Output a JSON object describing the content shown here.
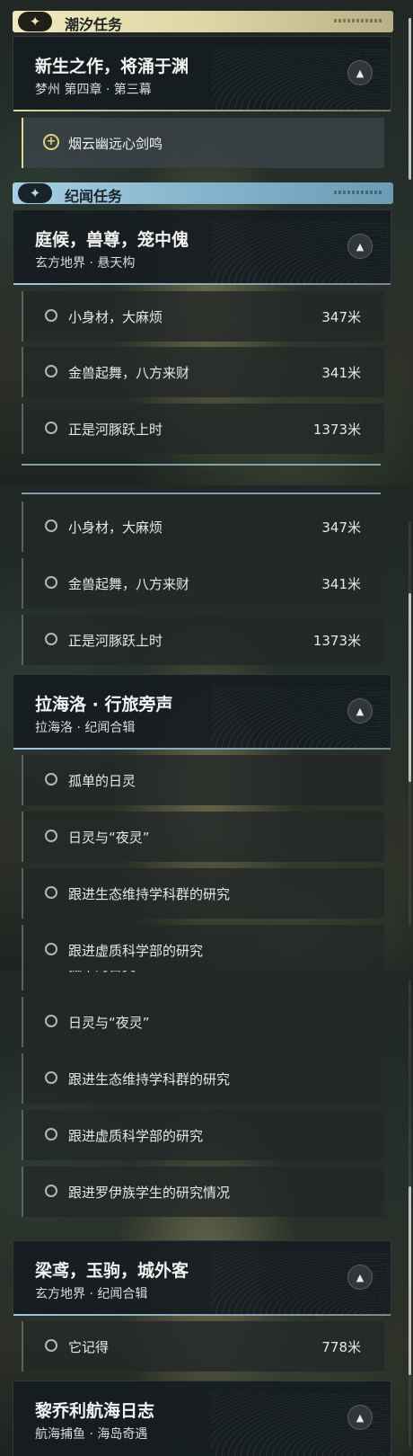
{
  "categories": {
    "tide": {
      "label": "潮汐任务",
      "icon": "star-icon"
    },
    "lore": {
      "label": "纪闻任务",
      "icon": "star-icon"
    }
  },
  "quests": {
    "xinsheng": {
      "title": "新生之作，将涌于渊",
      "subtitle": "梦州 第四章 · 第三幕",
      "objective": "烟云幽远心剑鸣"
    },
    "tinghou": {
      "title": "庭候，兽尊，笼中傀",
      "subtitle": "玄方地界 · 悬天构",
      "objectives": [
        {
          "label": "小身材，大麻烦",
          "distance": "347米"
        },
        {
          "label": "金兽起舞，八方来财",
          "distance": "341米"
        },
        {
          "label": "正是河豚跃上时",
          "distance": "1373米"
        }
      ]
    },
    "lahailuo": {
      "title": "拉海洛 · 行旅旁声",
      "subtitle": "拉海洛 · 纪闻合辑",
      "objectives": [
        {
          "label": "孤单的日灵"
        },
        {
          "label": "日灵与“夜灵”"
        },
        {
          "label": "跟进生态维持学科群的研究"
        },
        {
          "label": "跟进虚质科学部的研究"
        },
        {
          "label": "跟进罗伊族学生的研究情况"
        }
      ]
    },
    "liangyuan": {
      "title": "梁鸢，玉驹，城外客",
      "subtitle": "玄方地界 · 纪闻合辑",
      "objectives": [
        {
          "label": "它记得",
          "distance": "778米"
        }
      ]
    },
    "liqiaoli": {
      "title": "黎乔利航海日志",
      "subtitle": "航海捕鱼 · 海岛奇遇"
    }
  },
  "collapse_icon": "chevron-up-icon",
  "theme": {
    "tide_accent": "#e3d791",
    "lore_accent": "#8ec2db"
  }
}
